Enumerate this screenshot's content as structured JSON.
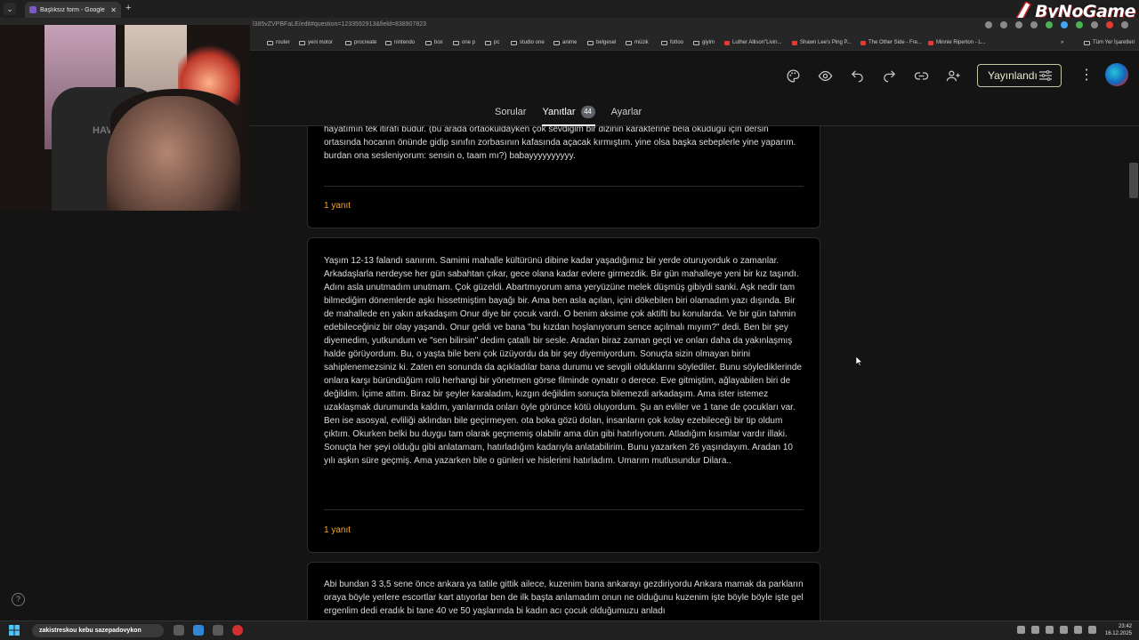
{
  "browser": {
    "tab_title": "Başlıksız form - Google Formlar",
    "tab_close": "✕",
    "new_tab": "+",
    "tab_list": "⌄",
    "url": "l385vZVPBFaLE/edit#question=1233592913&field=838907823",
    "watermark": "ByNoGame",
    "bookmarks": [
      {
        "label": "router",
        "icon": "folder-icon"
      },
      {
        "label": "yeni motor",
        "icon": "folder-icon"
      },
      {
        "label": "procreate",
        "icon": "folder-icon"
      },
      {
        "label": "nintendo",
        "icon": "folder-icon"
      },
      {
        "label": "box",
        "icon": "folder-icon"
      },
      {
        "label": "one p",
        "icon": "folder-icon"
      },
      {
        "label": "pc",
        "icon": "folder-icon"
      },
      {
        "label": "studio one",
        "icon": "folder-icon"
      },
      {
        "label": "anime",
        "icon": "folder-icon"
      },
      {
        "label": "belgesel",
        "icon": "folder-icon"
      },
      {
        "label": "müzik",
        "icon": "folder-icon"
      },
      {
        "label": "fottoo",
        "icon": "folder-icon"
      },
      {
        "label": "giyim",
        "icon": "folder-icon"
      },
      {
        "label": "Luther Allison\"Livin...",
        "icon": "youtube-icon"
      },
      {
        "label": "Shawn Lee's Ping P...",
        "icon": "youtube-icon"
      },
      {
        "label": "The Other Side - Fre...",
        "icon": "youtube-icon"
      },
      {
        "label": "Minnie Riperton - L...",
        "icon": "youtube-icon"
      },
      {
        "label": "»",
        "icon": ""
      },
      {
        "label": "Tüm Yer İşaretleri",
        "icon": "folder-icon"
      }
    ]
  },
  "webcam": {
    "chair_brand": "HAV"
  },
  "forms": {
    "publish_label": "Yayınlandı",
    "more_label": "⋮",
    "tabs": [
      {
        "label": "Sorular",
        "active": false
      },
      {
        "label": "Yanıtlar",
        "active": true,
        "count": "44"
      },
      {
        "label": "Ayarlar",
        "active": false
      }
    ],
    "responses": [
      {
        "text": "hayatımın tek itirafı budur. (bu arada ortaokuldayken çok sevdiğim bir dizinin karakterine bela okuduğu için dersin ortasında hocanın önünde gidip sınıfın zorbasının kafasında açacak kırmıştım. yine olsa başka sebeplerle yine yaparım. burdan ona sesleniyorum: sensin o, taam mı?) babayyyyyyyyyy.",
        "reply": "1 yanıt"
      },
      {
        "text": "Yaşım 12-13 falandı sanırım. Samimi mahalle kültürünü dibine kadar yaşadığımız bir yerde oturuyorduk o zamanlar. Arkadaşlarla nerdeyse her gün sabahtan çıkar, gece olana kadar evlere girmezdik. Bir gün mahalleye yeni bir kız taşındı. Adını asla unutmadım unutmam. Çok güzeldi. Abartmıyorum ama yeryüzüne melek düşmüş gibiydi sanki. Aşk nedir tam bilmediğim dönemlerde aşkı hissetmiştim bayağı bir. Ama ben asla açılan, içini dökebilen biri olamadım yazı dışında. Bir de mahallede en yakın arkadaşım Onur diye bir çocuk vardı. O benim aksime çok aktifti bu konularda. Ve bir gün tahmin edebileceğiniz bir olay yaşandı. Onur geldi ve bana \"bu kızdan hoşlanıyorum sence açılmalı mıyım?\" dedi. Ben bir şey diyemedim, yutkundum ve \"sen bilirsin\" dedim çatallı bir sesle. Aradan biraz zaman geçti ve onları daha da yakınlaşmış halde görüyordum. Bu, o yaşta bile beni çok üzüyordu da bir şey diyemiyordum. Sonuçta sizin olmayan birini sahiplenemezsiniz ki. Zaten en sonunda da açıkladılar bana durumu ve sevgili olduklarını söylediler. Bunu söylediklerinde onlara karşı büründüğüm rolü herhangi bir yönetmen görse filminde oynatır o derece. Eve gitmiştim, ağlayabilen biri de değildim. İçime attım. Biraz bir şeyler karaladım, kızgın değildim sonuçta bilemezdi arkadaşım. Ama ister istemez uzaklaşmak durumunda kaldım, yanlarında onları öyle görünce kötü oluyordum. Şu an evliler ve 1 tane de çocukları var. Ben ise asosyal, evliliği aklından bile geçirmeyen. ota boka gözü dolan, insanların çok kolay ezebileceği bir tip oldum çıktım. Okurken belki bu duygu tam olarak geçmemiş olabilir ama dün gibi hatırlıyorum. Atladığım kısımlar vardır illaki. Sonuçta her şeyi olduğu gibi anlatamam, hatırladığım kadarıyla anlatabilirim. Bunu yazarken 26 yaşındayım. Aradan 10 yılı aşkın süre geçmiş. Ama yazarken bile o günleri ve hislerimi hatırladım. Umarım mutlusundur Dilara..",
        "reply": "1 yanıt"
      },
      {
        "text": "Abi bundan 3 3,5 sene önce ankara ya tatile gittik ailece, kuzenim bana ankarayı gezdiriyordu Ankara mamak da parkların oraya böyle yerlere escortlar kart atıyorlar ben de ilk başta anlamadım onun ne olduğunu kuzenim işte böyle böyle işte gel ergenlim dedi eradık bi tane 40 ve 50 yaşlarında bi kadın acı çocuk olduğumuzu anladı",
        "reply": ""
      }
    ]
  },
  "taskbar": {
    "search_text": "zakistreskou kebu sazepadovykon",
    "time": "23:42",
    "date": "16.12.2025"
  },
  "colors": {
    "accent_reply": "#f6a623",
    "publish_border": "#c4c7a0",
    "background": "#141414",
    "card": "#000000"
  }
}
